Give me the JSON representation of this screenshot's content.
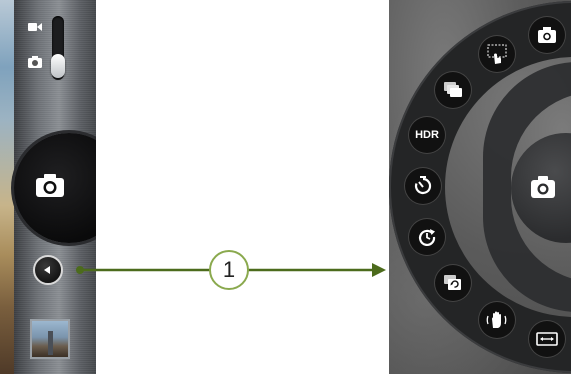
{
  "callout": {
    "number": "1"
  },
  "radial_menu": {
    "hdr_label": "HDR"
  },
  "colors": {
    "connector": "#4c6b1c",
    "callout_border": "#8aa94e"
  },
  "icons": {
    "mode_switch": [
      "video-camera-icon",
      "camera-icon"
    ],
    "left": [
      "camera-icon",
      "chevron-left-icon"
    ],
    "radial": [
      "camera-icon",
      "touch-capture-icon",
      "burst-icon",
      "hdr-icon",
      "self-timer-icon",
      "interval-icon",
      "panorama-switch-icon",
      "stabilizer-icon",
      "panorama-icon",
      "camera-icon"
    ]
  }
}
